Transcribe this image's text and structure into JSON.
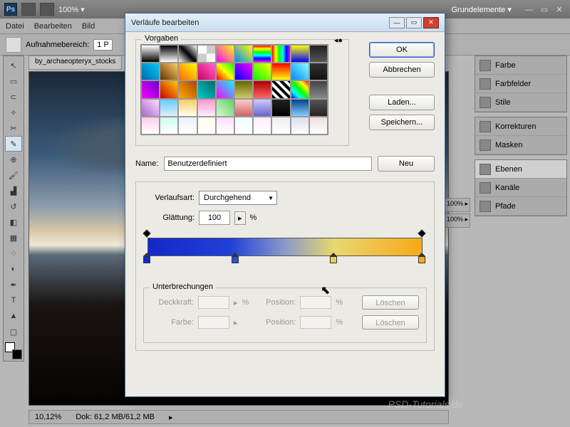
{
  "app": {
    "workspace_label": "Grundelemente ▾",
    "zoom_display": "100%  ▾"
  },
  "menu": {
    "file": "Datei",
    "edit": "Bearbeiten",
    "image": "Bild"
  },
  "options": {
    "sample_label": "Aufnahmebereich:",
    "sample_value": "1 P"
  },
  "document": {
    "tab": "by_archaeopteryx_stocks",
    "zoom": "10,12%",
    "docinfo": "Dok: 61,2 MB/61,2 MB"
  },
  "panels": {
    "color": "Farbe",
    "swatches": "Farbfelder",
    "styles": "Stile",
    "adjustments": "Korrekturen",
    "masks": "Masken",
    "layers": "Ebenen",
    "channels": "Kanäle",
    "paths": "Pfade",
    "opacity1": "100% ▸",
    "opacity2": "100% ▸"
  },
  "dialog": {
    "title": "Verläufe bearbeiten",
    "presets_label": "Vorgaben",
    "ok": "OK",
    "cancel": "Abbrechen",
    "load": "Laden...",
    "save": "Speichern...",
    "name_label": "Name:",
    "name_value": "Benutzerdefiniert",
    "new_btn": "Neu",
    "type_label": "Verlaufsart:",
    "type_value": "Durchgehend",
    "smooth_label": "Glättung:",
    "smooth_value": "100",
    "percent": "%",
    "stops_label": "Unterbrechungen",
    "opacity_label": "Deckkraft:",
    "color_label": "Farbe:",
    "position_label": "Position:",
    "delete": "Löschen"
  },
  "gradient_presets": [
    "linear-gradient(#fff,#000)",
    "linear-gradient(#000,#fff)",
    "linear-gradient(45deg,#fff,#000,#fff)",
    "repeating-conic-gradient(#ccc 0 25%,#fff 0 50%)",
    "linear-gradient(45deg,#f0f,#ff0)",
    "linear-gradient(45deg,#08f,#ff0)",
    "linear-gradient(#f00,#ff0,#0f0,#0ff,#00f,#f0f)",
    "linear-gradient(90deg,#f00,#ff0,#0f0,#0ff,#00f,#f0f)",
    "linear-gradient(#ff0,#00f)",
    "linear-gradient(#222,#555)",
    "linear-gradient(45deg,#06a,#0cf)",
    "linear-gradient(45deg,#630,#fc6)",
    "linear-gradient(45deg,#f60,#ff0)",
    "linear-gradient(45deg,#c06,#f6c)",
    "linear-gradient(45deg,#f00,#ff0,#0f0)",
    "linear-gradient(45deg,#00f,#f0f)",
    "linear-gradient(45deg,#0f0,#ff0)",
    "linear-gradient(#f00,#ff0)",
    "linear-gradient(45deg,#08f,#8ff)",
    "linear-gradient(#333,#111)",
    "linear-gradient(45deg,#f0f,#60c)",
    "linear-gradient(45deg,#c00,#fc0)",
    "linear-gradient(45deg,#fa0,#a40)",
    "linear-gradient(45deg,#0cc,#066)",
    "linear-gradient(45deg,#f0f,#0ff)",
    "linear-gradient(#660,#cc6)",
    "linear-gradient(#a00,#f66)",
    "repeating-linear-gradient(45deg,#000 0 4px,#fff 4px 8px)",
    "linear-gradient(45deg,#00f,#0ff,#0f0,#ff0,#f00)",
    "linear-gradient(#444,#888)",
    "linear-gradient(45deg,#a6c,#fdf)",
    "linear-gradient(#6cf,#def)",
    "linear-gradient(#fc6,#ffe)",
    "linear-gradient(#f9c,#fef)",
    "linear-gradient(45deg,#cfc,#6c6)",
    "linear-gradient(#fcc,#c66)",
    "linear-gradient(#ccf,#66c)",
    "linear-gradient(#222,#000)",
    "linear-gradient(#048,#8cf)",
    "linear-gradient(#555,#222)",
    "linear-gradient(#fce,#fff)",
    "linear-gradient(#cfe,#fff)",
    "linear-gradient(#eef,#fff)",
    "linear-gradient(#ffe,#fff)",
    "linear-gradient(#fdf,#fff)",
    "linear-gradient(#eff,#fff)",
    "linear-gradient(#fef,#fff)",
    "linear-gradient(#eee,#fff)",
    "linear-gradient(#dde,#fff)",
    "linear-gradient(#edd,#fff)"
  ],
  "gradient_stops": {
    "opacity": [
      {
        "pos": 0
      },
      {
        "pos": 100
      }
    ],
    "color": [
      {
        "pos": 0,
        "color": "#1428c8"
      },
      {
        "pos": 32,
        "color": "#2a50d8"
      },
      {
        "pos": 68,
        "color": "#e8d060"
      },
      {
        "pos": 100,
        "color": "#f8a818"
      }
    ]
  },
  "watermark": "PSD-Tutorials.de"
}
